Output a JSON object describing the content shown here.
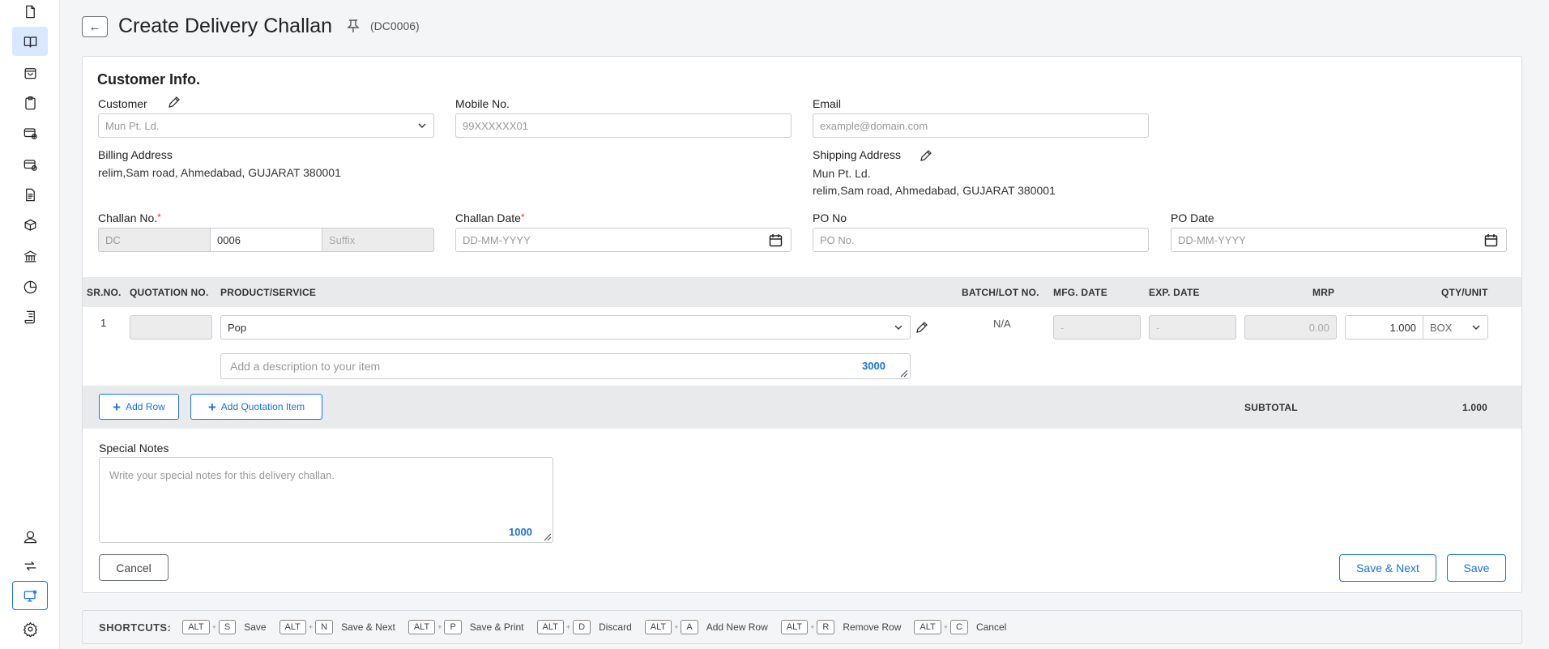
{
  "page": {
    "title": "Create Delivery Challan",
    "code": "(DC0006)"
  },
  "customer_info": {
    "section_title": "Customer Info.",
    "customer_label": "Customer",
    "customer_value": "Mun Pt. Ld.",
    "mobile_label": "Mobile No.",
    "mobile_placeholder": "99XXXXXX01",
    "email_label": "Email",
    "email_placeholder": "example@domain.com",
    "billing_label": "Billing Address",
    "billing_address": "relim,Sam road, Ahmedabad, GUJARAT 380001",
    "shipping_label": "Shipping Address",
    "shipping_name": "Mun Pt. Ld.",
    "shipping_address": "relim,Sam road, Ahmedabad, GUJARAT 380001"
  },
  "challan": {
    "no_label": "Challan No.",
    "prefix": "DC",
    "number": "0006",
    "suffix_placeholder": "Suffix",
    "date_label": "Challan Date",
    "date_placeholder": "DD-MM-YYYY",
    "po_no_label": "PO No",
    "po_no_placeholder": "PO No.",
    "po_date_label": "PO Date",
    "po_date_placeholder": "DD-MM-YYYY",
    "required_mark": "*"
  },
  "table": {
    "headers": {
      "sr": "SR.NO.",
      "quotation": "QUOTATION NO.",
      "product": "PRODUCT/SERVICE",
      "batch": "BATCH/LOT NO.",
      "mfg": "MFG. DATE",
      "exp": "EXP. DATE",
      "mrp": "MRP",
      "qty": "QTY/UNIT"
    },
    "rows": [
      {
        "sr": "1",
        "product": "Pop",
        "batch": "N/A",
        "mfg": "-",
        "exp": "-",
        "mrp": "0.00",
        "qty": "1.000",
        "unit": "BOX",
        "description_placeholder": "Add a description to your item",
        "description_count": "3000"
      }
    ],
    "add_row_label": "Add Row",
    "add_quotation_label": "Add Quotation Item",
    "subtotal_label": "SUBTOTAL",
    "subtotal_value": "1.000"
  },
  "notes": {
    "label": "Special Notes",
    "placeholder": "Write your special notes for this delivery challan.",
    "count": "1000"
  },
  "actions": {
    "cancel": "Cancel",
    "save_next": "Save & Next",
    "save": "Save"
  },
  "shortcuts": {
    "label": "SHORTCUTS:",
    "items": [
      {
        "mod": "ALT",
        "key": "S",
        "text": "Save"
      },
      {
        "mod": "ALT",
        "key": "N",
        "text": "Save & Next"
      },
      {
        "mod": "ALT",
        "key": "P",
        "text": "Save & Print"
      },
      {
        "mod": "ALT",
        "key": "D",
        "text": "Discard"
      },
      {
        "mod": "ALT",
        "key": "A",
        "text": "Add New Row"
      },
      {
        "mod": "ALT",
        "key": "R",
        "text": "Remove Row"
      },
      {
        "mod": "ALT",
        "key": "C",
        "text": "Cancel"
      }
    ]
  },
  "sidebar": {
    "icons": [
      "document-icon",
      "book-icon",
      "bag-icon",
      "clipboard-icon",
      "card-add-icon",
      "card-check-icon",
      "invoice-icon",
      "box-settings-icon",
      "bank-icon",
      "pie-chart-icon",
      "ledger-icon",
      "user-icon",
      "sync-icon",
      "monitor-icon",
      "settings-icon"
    ]
  }
}
